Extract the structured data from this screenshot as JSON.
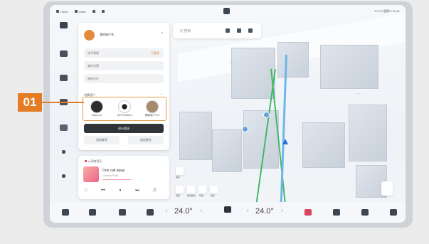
{
  "status_bar": {
    "items": [
      "Home",
      "Office",
      "",
      ""
    ],
    "right_text": "10°/12 星期二 09:41"
  },
  "search": {
    "placeholder": "Q 搜索"
  },
  "profile_panel": {
    "account_name": "我的账户名",
    "rows": [
      {
        "label": "账号管理",
        "tag": "已登录"
      },
      {
        "label": "偏好设置"
      },
      {
        "label": "座椅记忆"
      }
    ],
    "section_title": "切换用户",
    "users": [
      {
        "name": "Daisy Liu"
      },
      {
        "name": "18712345123"
      },
      {
        "name": "需要用户TC2"
      }
    ],
    "primary_button": "进行登录",
    "secondary_buttons": [
      "添加账号",
      "退出账号"
    ]
  },
  "media": {
    "header": "● 网络音乐",
    "song": "One call away",
    "artist": "Charlie Puth",
    "controls": [
      "♡",
      "⏮",
      "⏸",
      "⏭",
      "⤮"
    ]
  },
  "map_widget": {
    "labels": [
      "路况",
      "返回",
      "规划路线",
      "导航",
      "更多"
    ]
  },
  "dock": {
    "temp_left": "24.0°",
    "temp_right": "24.0°"
  },
  "callout": {
    "label": "01"
  },
  "colors": {
    "accent": "#e37c25",
    "dark_button": "#2f3438"
  }
}
